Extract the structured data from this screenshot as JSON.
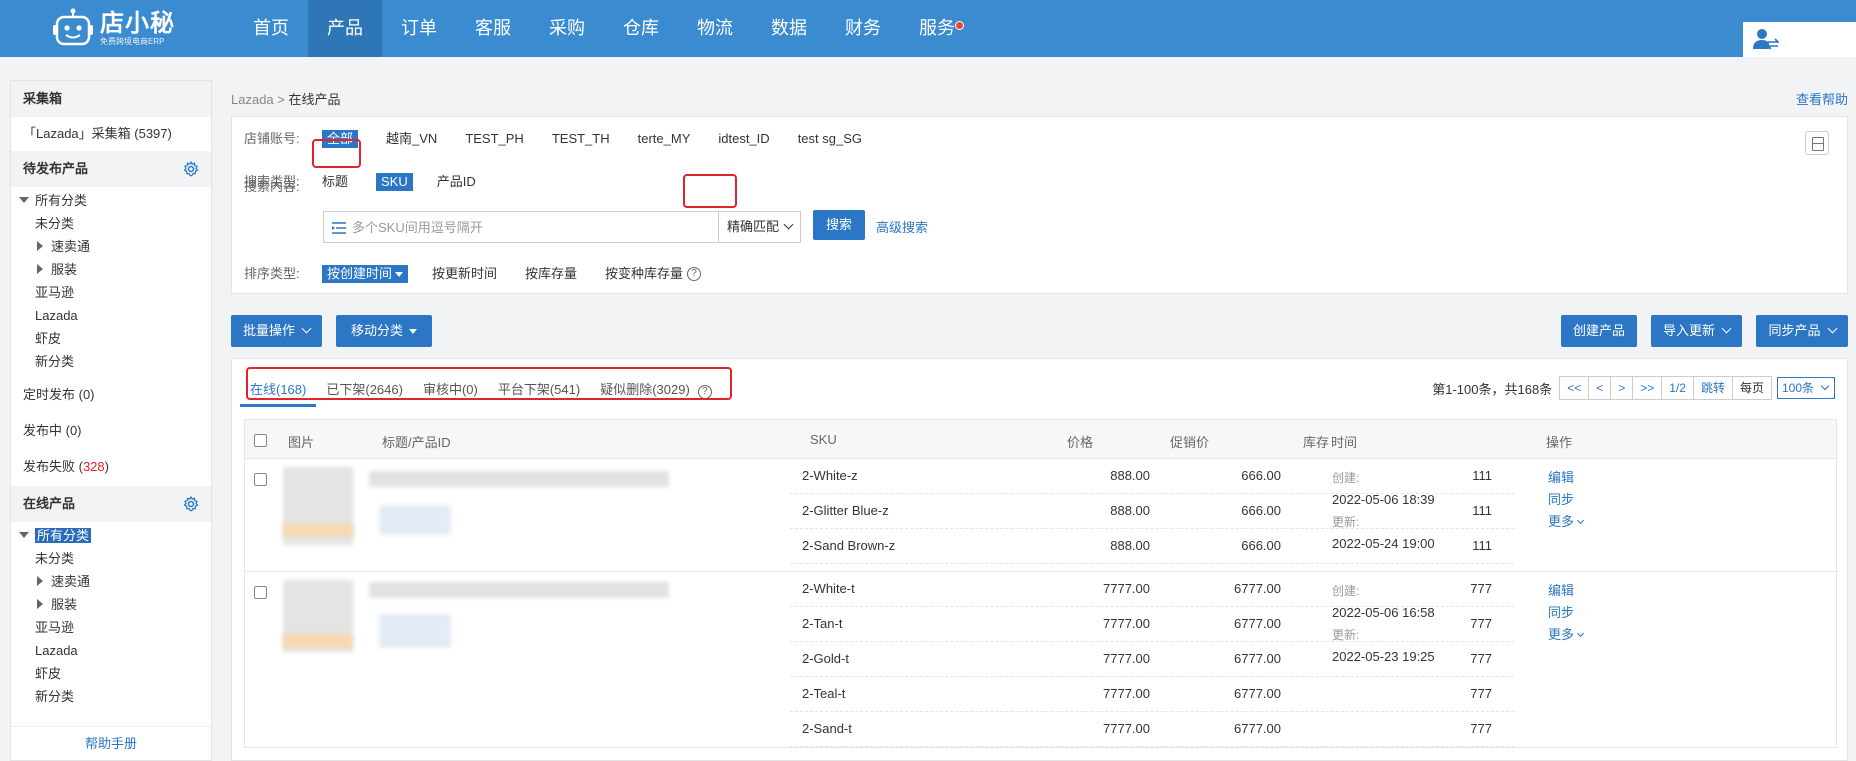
{
  "brand": {
    "name": "店小秘",
    "tagline": "免费跨境电商ERP"
  },
  "nav": {
    "items": [
      {
        "label": "首页"
      },
      {
        "label": "产品"
      },
      {
        "label": "订单"
      },
      {
        "label": "客服"
      },
      {
        "label": "采购"
      },
      {
        "label": "仓库"
      },
      {
        "label": "物流"
      },
      {
        "label": "数据"
      },
      {
        "label": "财务"
      },
      {
        "label": "服务"
      }
    ],
    "active_index": 1
  },
  "sidebar": {
    "collect_box": {
      "title": "采集箱",
      "item": "「Lazada」采集箱 (5397)"
    },
    "pending": {
      "title": "待发布产品",
      "tree": [
        "所有分类",
        "未分类",
        "速卖通",
        "服装",
        "亚马逊",
        "Lazada",
        "虾皮",
        "新分类"
      ],
      "scheduled": "定时发布 (0)",
      "publishing": "发布中 (0)",
      "failed_label": "发布失败 (",
      "failed_count": "328",
      "failed_suffix": ")"
    },
    "online": {
      "title": "在线产品",
      "tree": [
        "所有分类",
        "未分类",
        "速卖通",
        "服装",
        "亚马逊",
        "Lazada",
        "虾皮",
        "新分类"
      ]
    },
    "help": "帮助手册"
  },
  "breadcrumb": {
    "root": "Lazada",
    "sep": ">",
    "current": "在线产品"
  },
  "help_link": "查看帮助",
  "filters": {
    "shop_label": "店铺账号:",
    "shops": [
      "全部",
      "越南_VN",
      "TEST_PH",
      "TEST_TH",
      "terte_MY",
      "idtest_ID",
      "test sg_SG"
    ],
    "search_type_label": "搜索类型:",
    "search_types": [
      "标题",
      "SKU",
      "产品ID"
    ],
    "content_label": "搜索内容:",
    "search_placeholder": "多个SKU间用逗号隔开",
    "match_mode": "精确匹配",
    "search_button": "搜索",
    "advanced_search": "高级搜索",
    "sort_label": "排序类型:",
    "sorts": [
      "按创建时间",
      "按更新时间",
      "按库存量",
      "按变种库存量"
    ]
  },
  "actions": {
    "batch": "批量操作",
    "move_category": "移动分类",
    "create_product": "创建产品",
    "import_update": "导入更新",
    "sync_product": "同步产品"
  },
  "tabs": [
    "在线(168)",
    "已下架(2646)",
    "审核中(0)",
    "平台下架(541)",
    "疑似删除(3029)"
  ],
  "pager": {
    "summary": "第1-100条，共168条",
    "first": "<<",
    "prev": "<",
    "next": ">",
    "last": ">>",
    "page": "1/2",
    "jump": "跳转",
    "per_page_label": "每页",
    "per_page": "100条"
  },
  "table": {
    "headers": {
      "image": "图片",
      "title": "标题/产品ID",
      "sku": "SKU",
      "price": "价格",
      "promo": "促销价",
      "stock": "库存",
      "time": "时间",
      "ops": "操作"
    },
    "rows": [
      {
        "skus": [
          {
            "sku": "2-White-z",
            "price": "888.00",
            "promo": "666.00",
            "stock": "111"
          },
          {
            "sku": "2-Glitter Blue-z",
            "price": "888.00",
            "promo": "666.00",
            "stock": "111"
          },
          {
            "sku": "2-Sand Brown-z",
            "price": "888.00",
            "promo": "666.00",
            "stock": "111"
          }
        ],
        "created_label": "创建:",
        "created": "2022-05-06 18:39",
        "updated_label": "更新:",
        "updated": "2022-05-24 19:00",
        "ops": [
          "编辑",
          "同步",
          "更多"
        ]
      },
      {
        "skus": [
          {
            "sku": "2-White-t",
            "price": "7777.00",
            "promo": "6777.00",
            "stock": "777"
          },
          {
            "sku": "2-Tan-t",
            "price": "7777.00",
            "promo": "6777.00",
            "stock": "777"
          },
          {
            "sku": "2-Gold-t",
            "price": "7777.00",
            "promo": "6777.00",
            "stock": "777"
          },
          {
            "sku": "2-Teal-t",
            "price": "7777.00",
            "promo": "6777.00",
            "stock": "777"
          },
          {
            "sku": "2-Sand-t",
            "price": "7777.00",
            "promo": "6777.00",
            "stock": "777"
          }
        ],
        "created_label": "创建:",
        "created": "2022-05-06 16:58",
        "updated_label": "更新:",
        "updated": "2022-05-23 19:25",
        "ops": [
          "编辑",
          "同步",
          "更多"
        ]
      }
    ]
  },
  "colors": {
    "nav_bg": "#3b8bd0",
    "accent": "#2b76c5",
    "highlight_box": "#e0232d",
    "failed_count": "#e0232d"
  }
}
